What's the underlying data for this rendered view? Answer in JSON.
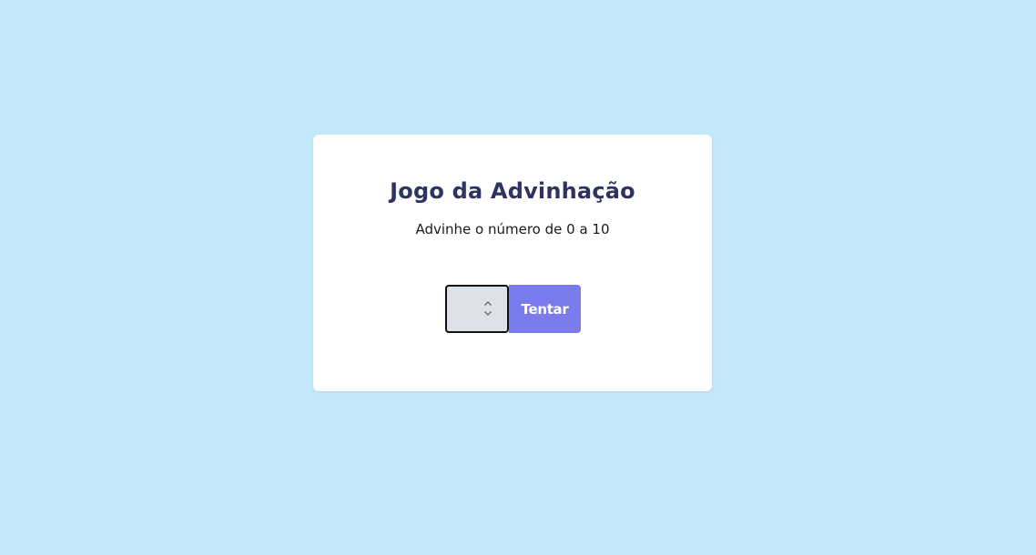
{
  "game": {
    "title": "Jogo da Advinhação",
    "subtitle": "Advinhe o número de 0 a 10"
  },
  "guess_input": {
    "value": "",
    "spinner_icon": "up-down-chevron-icon"
  },
  "try_button": {
    "label": "Tentar"
  },
  "colors": {
    "background": "#c3e8f9",
    "card": "#ffffff",
    "title": "#2e335f",
    "button": "#7a7bec",
    "input_bg": "#dde2ea"
  }
}
